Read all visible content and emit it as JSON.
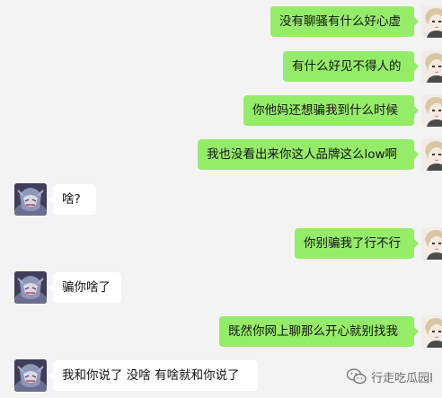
{
  "messages": [
    {
      "side": "mine",
      "text": "没有聊骚有什么好心虚"
    },
    {
      "side": "mine",
      "text": "有什么好见不得人的"
    },
    {
      "side": "mine",
      "text": "你他妈还想骗我到什么时候"
    },
    {
      "side": "mine",
      "text": "我也没看出来你这人品牌这么low啊"
    },
    {
      "side": "theirs",
      "text": "啥?"
    },
    {
      "side": "mine",
      "text": "你别骗我了行不行"
    },
    {
      "side": "theirs",
      "text": "骗你啥了"
    },
    {
      "side": "mine",
      "text": "既然你网上聊那么开心就别找我"
    },
    {
      "side": "theirs",
      "text": "我和你说了 没啥 有啥就和你说了"
    }
  ],
  "watermark": {
    "text": "行走吃瓜园I",
    "icon": "wechat-icon"
  },
  "colors": {
    "background": "#f3f3f3",
    "mine_bubble": "#95ec69",
    "theirs_bubble": "#ffffff"
  }
}
